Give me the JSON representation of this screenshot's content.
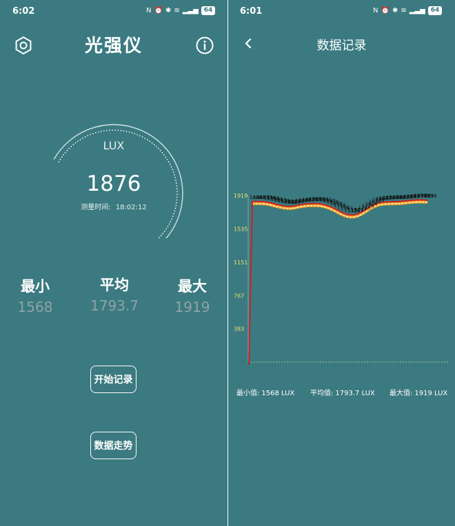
{
  "left": {
    "status": {
      "time": "6:02",
      "battery": "64"
    },
    "title": "光强仪",
    "gauge": {
      "unit": "LUX",
      "value": "1876",
      "time_label": "测量时间:",
      "time_value": "18:02:12",
      "level": 0.85
    },
    "stats": {
      "min_label": "最小",
      "min_value": "1568",
      "avg_label": "平均",
      "avg_value": "1793.7",
      "max_label": "最大",
      "max_value": "1919"
    },
    "buttons": {
      "record": "开始记录",
      "trend": "数据走势"
    }
  },
  "right": {
    "status": {
      "time": "6:01",
      "battery": "64"
    },
    "title": "数据记录",
    "chart_data": {
      "type": "line",
      "y_ticks": [
        "383",
        "767",
        "1151",
        "1535",
        "1919"
      ],
      "y_tick_values": [
        383,
        767,
        1151,
        1535,
        1919
      ],
      "ylim": [
        0,
        1919
      ],
      "grid": false,
      "colors": {
        "main": "#cc2222",
        "shadow": "#f5a623",
        "ticks": "#e8e070"
      },
      "point_labels": "black",
      "series": [
        {
          "values": [
            0,
            1880,
            1881,
            1881,
            1879,
            1876,
            1868,
            1858,
            1847,
            1838,
            1830,
            1826,
            1825,
            1830,
            1838,
            1846,
            1852,
            1856,
            1858,
            1858,
            1856,
            1850,
            1840,
            1826,
            1808,
            1788,
            1766,
            1747,
            1733,
            1726,
            1727,
            1737,
            1755,
            1779,
            1806,
            1830,
            1850,
            1864,
            1872,
            1876,
            1878,
            1879,
            1880,
            1882,
            1885,
            1889,
            1893,
            1897,
            1899,
            1900,
            1899,
            1896
          ]
        }
      ]
    },
    "summary": {
      "min_label": "最小值:",
      "min_value": "1568 LUX",
      "avg_label": "平均值:",
      "avg_value": "1793.7 LUX",
      "max_label": "最大值:",
      "max_value": "1919 LUX"
    }
  }
}
